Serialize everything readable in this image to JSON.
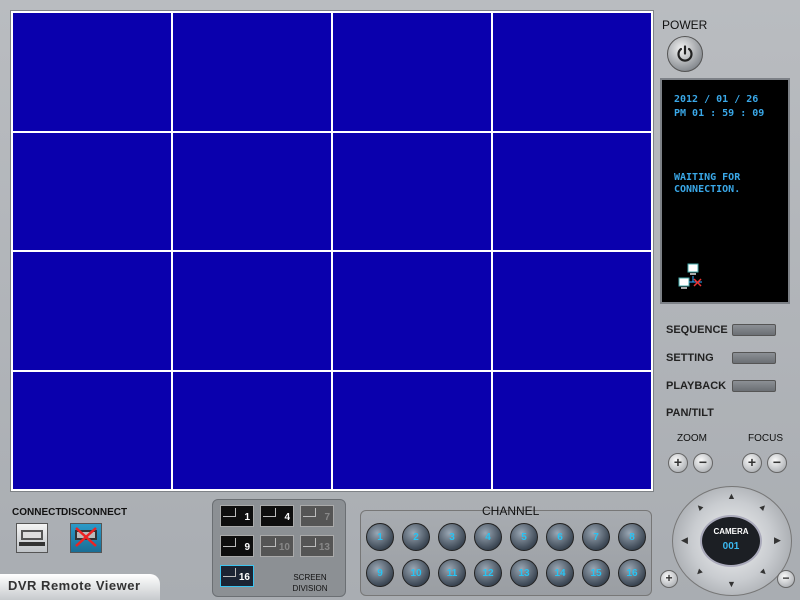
{
  "video_grid": {
    "cells": 16
  },
  "power": {
    "label": "POWER"
  },
  "status": {
    "date": "2012 / 01 / 26",
    "time": "PM 01 : 59 : 09",
    "message_line1": "WAITING FOR",
    "message_line2": "CONNECTION."
  },
  "menu": {
    "sequence": "SEQUENCE",
    "setting": "SETTING",
    "playback": "PLAYBACK",
    "pan_tilt": "PAN/TILT",
    "zoom": "ZOOM",
    "focus": "FOCUS"
  },
  "camera": {
    "label": "CAMERA",
    "number": "001"
  },
  "connection": {
    "connect": "CONNECT",
    "disconnect": "DISCONNECT"
  },
  "app_title": "DVR Remote Viewer",
  "screen_division": {
    "label_line1": "SCREEN",
    "label_line2": "DIVISION",
    "buttons": [
      {
        "label": "1",
        "state": "enabled"
      },
      {
        "label": "4",
        "state": "enabled"
      },
      {
        "label": "7",
        "state": "disabled"
      },
      {
        "label": "9",
        "state": "enabled"
      },
      {
        "label": "10",
        "state": "disabled"
      },
      {
        "label": "13",
        "state": "disabled"
      },
      {
        "label": "16",
        "state": "active"
      }
    ]
  },
  "channel": {
    "label": "CHANNEL",
    "buttons": [
      "1",
      "2",
      "3",
      "4",
      "5",
      "6",
      "7",
      "8",
      "9",
      "10",
      "11",
      "12",
      "13",
      "14",
      "15",
      "16"
    ]
  },
  "colors": {
    "video_bg": "#0a00ad",
    "status_text": "#3aa8e8",
    "accent": "#28c3f2"
  }
}
